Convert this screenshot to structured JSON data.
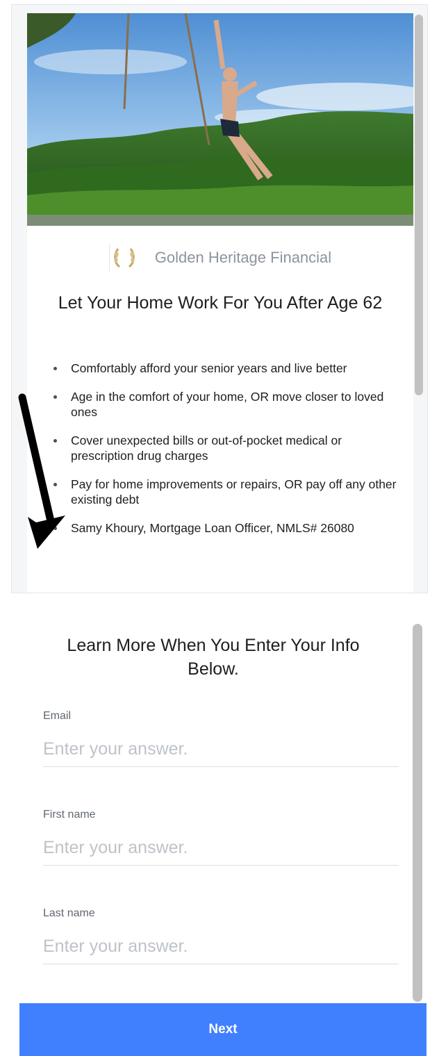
{
  "ad": {
    "brand_name": "Golden Heritage Financial",
    "title": "Let Your Home Work For You After Age 62",
    "bullets": [
      "Comfortably afford your senior years and live better",
      "Age in the comfort of your home, OR move closer to loved ones",
      "Cover unexpected bills or out-of-pocket medical or prescription drug charges",
      "Pay for home improvements or repairs, OR pay off any other existing debt",
      "Samy Khoury, Mortgage Loan Officer, NMLS# 26080"
    ]
  },
  "form": {
    "title": "Learn More When You Enter Your Info Below.",
    "fields": [
      {
        "label": "Email",
        "placeholder": "Enter your answer.",
        "value": ""
      },
      {
        "label": "First name",
        "placeholder": "Enter your answer.",
        "value": ""
      },
      {
        "label": "Last name",
        "placeholder": "Enter your answer.",
        "value": ""
      }
    ],
    "next_label": "Next"
  },
  "colors": {
    "accent": "#4080ff",
    "label_gray": "#606770",
    "placeholder_gray": "#bec3c9",
    "brand_gray": "#8d949e"
  },
  "icons": {
    "brand_logo": "laurel-wreath-icon",
    "annotation": "arrow-down-icon"
  }
}
